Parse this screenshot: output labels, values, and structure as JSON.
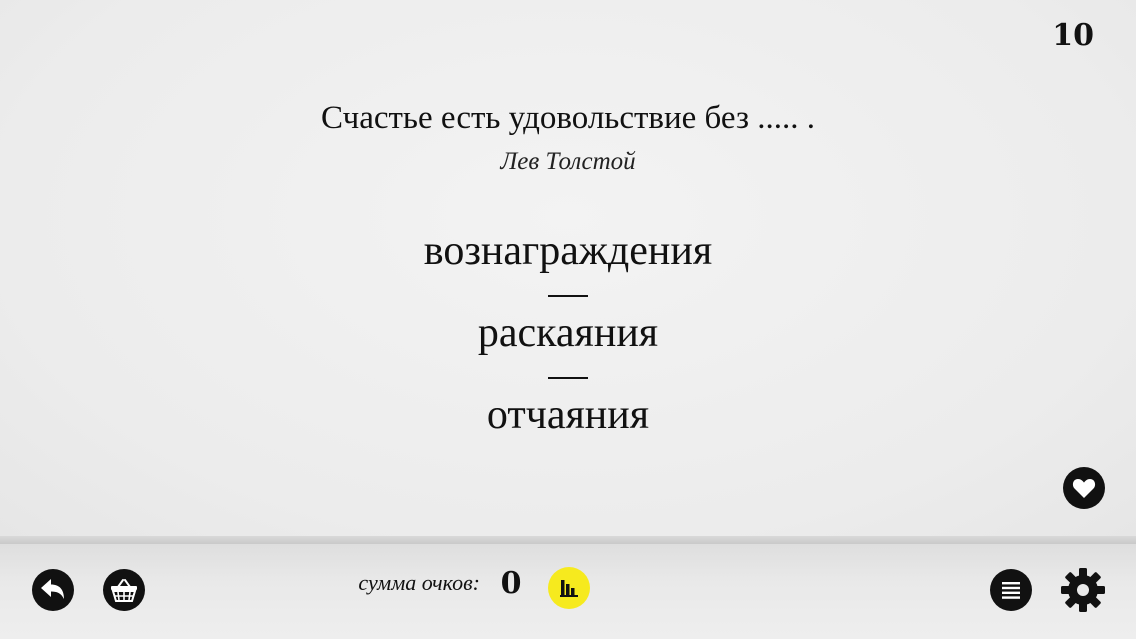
{
  "level": "10",
  "question": {
    "quote": "Счастье есть удовольствие без ..... .",
    "author": "Лев Толстой"
  },
  "answers": [
    "вознаграждения",
    "раскаяния",
    "отчаяния"
  ],
  "score": {
    "label": "сумма очков:",
    "value": "0"
  },
  "icons": {
    "back": "back-arrow-icon",
    "shop": "basket-icon",
    "leaderboard": "bar-chart-icon",
    "list": "list-icon",
    "settings": "gear-icon",
    "favorite": "heart-icon"
  },
  "colors": {
    "accent": "#f6ea1e",
    "ink": "#111111"
  }
}
